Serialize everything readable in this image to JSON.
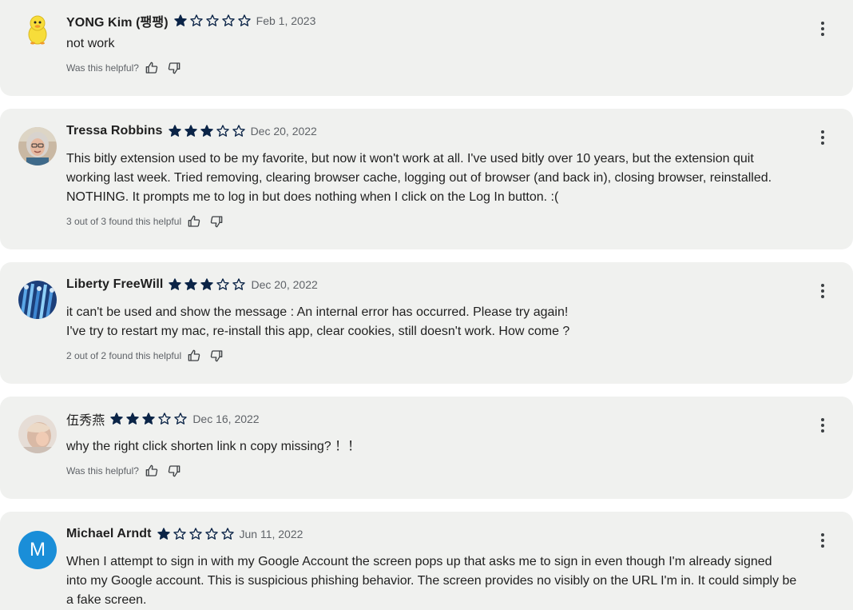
{
  "reviews": [
    {
      "name": "YONG Kim (팽팽)",
      "rating": 1,
      "date": "Feb 1, 2023",
      "text": "not work",
      "helpful_text": "Was this helpful?",
      "avatar": "duck-avatar"
    },
    {
      "name": "Tressa Robbins",
      "rating": 3,
      "date": "Dec 20, 2022",
      "text": "This bitly extension used to be my favorite, but now it won't work at all. I've used bitly over 10 years, but the extension quit\nworking last week. Tried removing, clearing browser cache, logging out of browser (and back in), closing browser, reinstalled.\nNOTHING. It prompts me to log in but does nothing when I click on the Log In button. :(",
      "helpful_text": "3 out of 3 found this helpful",
      "avatar": "photo-avatar"
    },
    {
      "name": "Liberty FreeWill",
      "rating": 3,
      "date": "Dec 20, 2022",
      "text": "it can't be used and show the message : An internal error has occurred. Please try again!\nI've try to restart my mac, re-install this app, clear cookies, still doesn't work. How come ?",
      "helpful_text": "2 out of 2 found this helpful",
      "avatar": "photo-avatar"
    },
    {
      "name": "伍秀燕",
      "rating": 3,
      "date": "Dec 16, 2022",
      "text": "why the right click shorten link n copy missing? ！！",
      "helpful_text": "Was this helpful?",
      "avatar": "photo-avatar"
    },
    {
      "name": "Michael Arndt",
      "rating": 1,
      "date": "Jun 11, 2022",
      "text": "When I attempt to sign in with my Google Account the screen pops up that asks me to sign in even though I'm already signed\ninto my Google account. This is suspicious phishing behavior. The screen provides no visibly on the URL I'm in. It could simply be\na fake screen.",
      "avatar_letter": "M",
      "avatar": "letter-avatar"
    }
  ],
  "colors": {
    "card_bg": "#f0f1ef",
    "star": "#0b2447",
    "avatar_letter_bg": "#1a8ed8",
    "secondary_text": "#5f6368"
  },
  "icons": {
    "filled_star": "star-filled-icon",
    "empty_star": "star-outline-icon",
    "thumbs_up": "thumbs-up-icon",
    "thumbs_down": "thumbs-down-icon",
    "more": "more-vert-icon"
  }
}
